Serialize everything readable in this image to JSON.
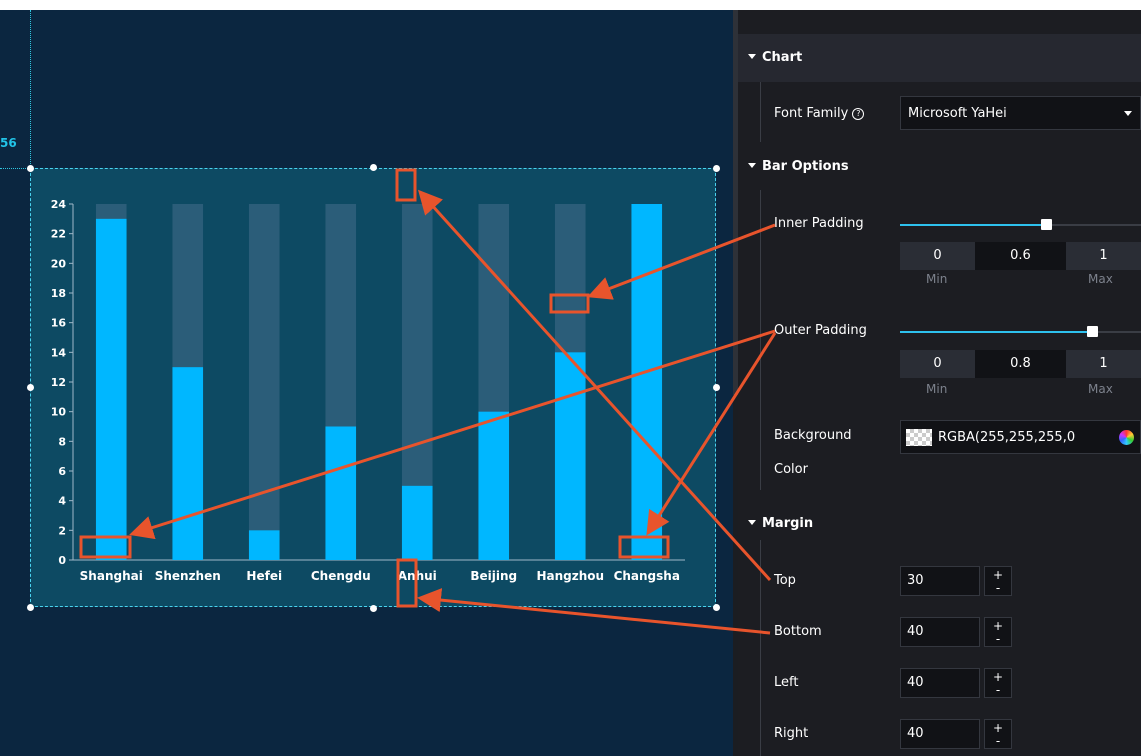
{
  "canvas": {
    "ruler_number": "56"
  },
  "chart_data": {
    "type": "bar",
    "categories": [
      "Shanghai",
      "Shenzhen",
      "Hefei",
      "Chengdu",
      "Anhui",
      "Beijing",
      "Hangzhou",
      "Changsha"
    ],
    "values": [
      23,
      13,
      2,
      9,
      5,
      10,
      14,
      24
    ],
    "background_max": 24,
    "ylim": [
      0,
      24
    ],
    "yticks": [
      0,
      2,
      4,
      6,
      8,
      10,
      12,
      14,
      16,
      18,
      20,
      22,
      24
    ],
    "title": "",
    "xlabel": "",
    "ylabel": "",
    "bar_color": "#00b7ff",
    "background_bar_color": "#2b5d79",
    "axis_text_color": "#ffffff"
  },
  "panel": {
    "chart_section": "Chart",
    "font_family_label": "Font Family",
    "help_icon": "question-circle-icon",
    "font_family_value": "Microsoft YaHei",
    "bar_options_section": "Bar Options",
    "inner_padding": {
      "label": "Inner Padding",
      "min": "0",
      "value": "0.6",
      "max": "1",
      "min_label": "Min",
      "max_label": "Max",
      "fraction": 0.6
    },
    "outer_padding": {
      "label": "Outer Padding",
      "min": "0",
      "value": "0.8",
      "max": "1",
      "min_label": "Min",
      "max_label": "Max",
      "fraction": 0.8
    },
    "background_color_label_1": "Background",
    "background_color_label_2": "Color",
    "background_color_value": "RGBA(255,255,255,0",
    "margin_section": "Margin",
    "margin": [
      {
        "label": "Top",
        "value": "30"
      },
      {
        "label": "Bottom",
        "value": "40"
      },
      {
        "label": "Left",
        "value": "40"
      },
      {
        "label": "Right",
        "value": "40"
      }
    ],
    "plus": "+",
    "minus": "-",
    "accent_color": "#2ec1ee"
  },
  "annotation_color": "#e8542c"
}
